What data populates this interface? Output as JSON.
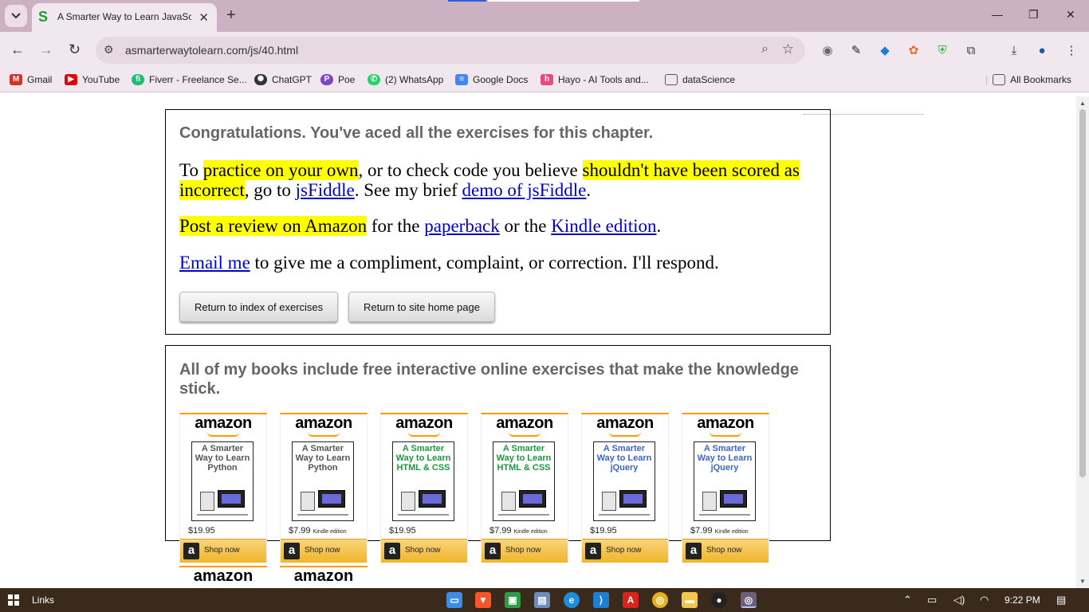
{
  "browser": {
    "tab_title": "A Smarter Way to Learn JavaScript",
    "favicon_letter": "S",
    "new_tab": "+",
    "url": "asmarterwaytolearn.com/js/40.html",
    "window_controls": {
      "minimize": "—",
      "restore": "❐",
      "close": "✕"
    },
    "bookmarks": [
      {
        "label": "Gmail",
        "icon": "gmail-icon",
        "color": "#d93025",
        "glyph": "M"
      },
      {
        "label": "YouTube",
        "icon": "youtube-icon",
        "color": "#e00000",
        "glyph": "▶"
      },
      {
        "label": "Fiverr - Freelance Se...",
        "icon": "fiverr-icon",
        "color": "#1dbf73",
        "glyph": "fi"
      },
      {
        "label": "ChatGPT",
        "icon": "chatgpt-icon",
        "color": "#333333",
        "glyph": "✺"
      },
      {
        "label": "Poe",
        "icon": "poe-icon",
        "color": "#7b47c7",
        "glyph": "P"
      },
      {
        "label": "(2) WhatsApp",
        "icon": "whatsapp-icon",
        "color": "#25d366",
        "glyph": "✆"
      },
      {
        "label": "Google Docs",
        "icon": "google-docs-icon",
        "color": "#4285f4",
        "glyph": "≡"
      },
      {
        "label": "Hayo - AI Tools and...",
        "icon": "hayo-icon",
        "color": "#e84a7a",
        "glyph": "h"
      },
      {
        "label": "dataScience",
        "icon": "folder-icon",
        "color": "#555555",
        "glyph": "▭"
      }
    ],
    "all_bookmarks": "All Bookmarks"
  },
  "page": {
    "congrats": "Congratulations. You've aced all the exercises for this chapter.",
    "p1": {
      "t1": "To ",
      "h1": "practice on your own",
      "t2": ", or to check code you believe ",
      "h2": "shouldn't have been scored as incorrect",
      "t3": ", go to ",
      "l1": "jsFiddle",
      "t4": ". See my brief ",
      "l2": "demo of jsFiddle",
      "t5": "."
    },
    "p2": {
      "h1": "Post a review on Amazon",
      "t1": " for the ",
      "l1": "paperback",
      "t2": " or the ",
      "l2": "Kindle edition",
      "t3": "."
    },
    "p3": {
      "l1": "Email me",
      "t1": " to give me a compliment, complaint, or correction. I'll respond."
    },
    "buttons": {
      "index": "Return to index of exercises",
      "home": "Return to site home page"
    },
    "books_heading": "All of my books include free interactive online exercises that make the knowledge stick.",
    "books": [
      {
        "title": "A Smarter Way to Learn Python",
        "price": "$19.95",
        "edition": "",
        "color": "#555555"
      },
      {
        "title": "A Smarter Way to Learn Python",
        "price": "$7.99",
        "edition": "Kindle edition",
        "color": "#555555"
      },
      {
        "title": "A Smarter Way to Learn HTML & CSS",
        "price": "$19.95",
        "edition": "",
        "color": "#1a9a3a"
      },
      {
        "title": "A Smarter Way to Learn HTML & CSS",
        "price": "$7.99",
        "edition": "Kindle edition",
        "color": "#1a9a3a"
      },
      {
        "title": "A Smarter Way to Learn jQuery",
        "price": "$19.95",
        "edition": "",
        "color": "#3a66c8"
      },
      {
        "title": "A Smarter Way to Learn jQuery",
        "price": "$7.99",
        "edition": "Kindle edition",
        "color": "#3a66c8"
      }
    ],
    "amazon_logo": "amazon",
    "shop_now": "Shop now",
    "amazon_a": "a"
  },
  "taskbar": {
    "links": "Links",
    "time": "9:22 PM"
  }
}
